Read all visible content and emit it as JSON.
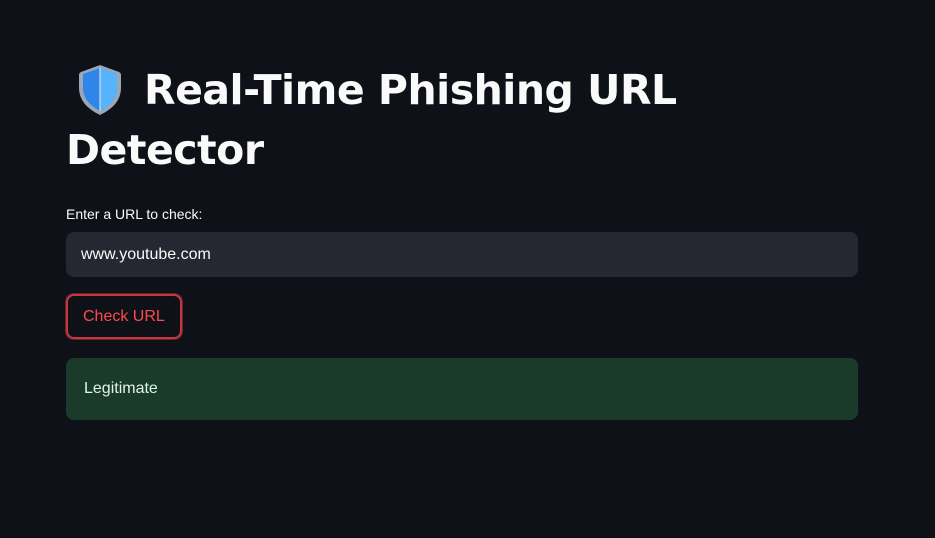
{
  "page": {
    "title_line1": "Real-Time Phishing URL",
    "title_line2": "Detector",
    "title_icon": "shield-icon"
  },
  "form": {
    "label": "Enter a URL to check:",
    "url_value": "www.youtube.com",
    "button_label": "Check URL"
  },
  "result": {
    "text": "Legitimate",
    "status": "success"
  },
  "colors": {
    "background": "#0e1117",
    "input_background": "#262730",
    "button_accent": "#ff4b4b",
    "success_background": "#1b3b2a",
    "text": "#fafafa"
  }
}
